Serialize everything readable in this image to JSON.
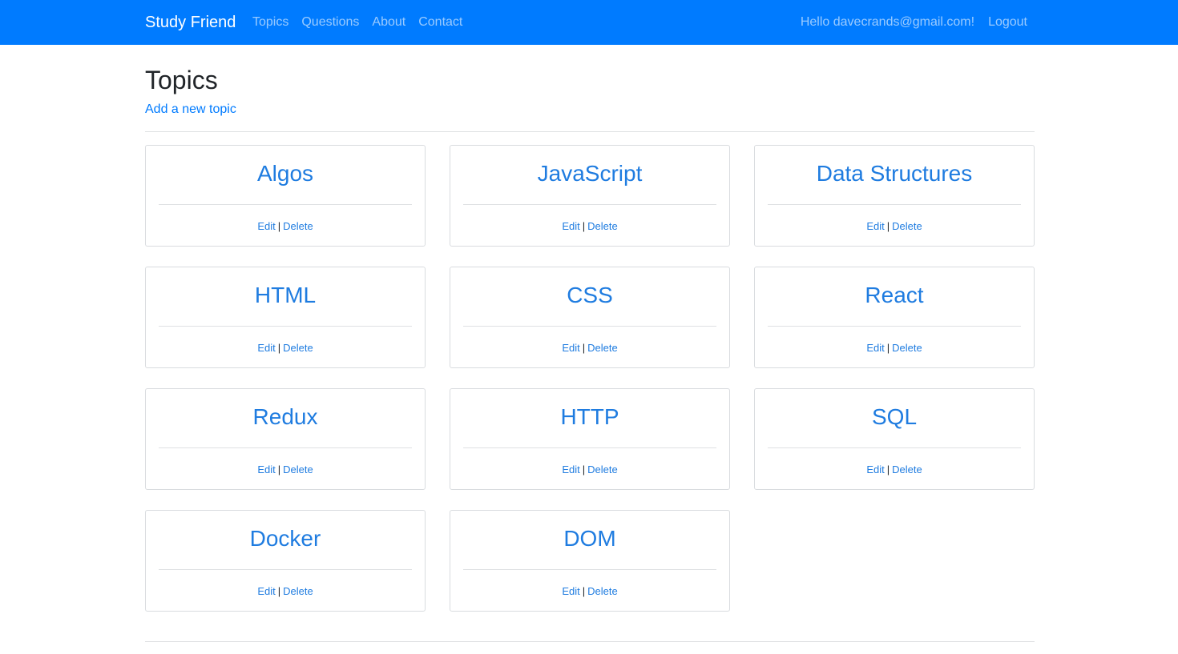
{
  "navbar": {
    "brand": "Study Friend",
    "links": [
      "Topics",
      "Questions",
      "About",
      "Contact"
    ],
    "greeting": "Hello davecrands@gmail.com!",
    "logout": "Logout"
  },
  "page": {
    "title": "Topics",
    "add_link": "Add a new topic"
  },
  "topics": [
    {
      "name": "Algos",
      "edit": "Edit",
      "sep": "|",
      "delete": "Delete"
    },
    {
      "name": "JavaScript",
      "edit": "Edit",
      "sep": "|",
      "delete": "Delete"
    },
    {
      "name": "Data Structures",
      "edit": "Edit",
      "sep": "|",
      "delete": "Delete"
    },
    {
      "name": "HTML",
      "edit": "Edit",
      "sep": "|",
      "delete": "Delete"
    },
    {
      "name": "CSS",
      "edit": "Edit",
      "sep": "|",
      "delete": "Delete"
    },
    {
      "name": "React",
      "edit": "Edit",
      "sep": "|",
      "delete": "Delete"
    },
    {
      "name": "Redux",
      "edit": "Edit",
      "sep": "|",
      "delete": "Delete"
    },
    {
      "name": "HTTP",
      "edit": "Edit",
      "sep": "|",
      "delete": "Delete"
    },
    {
      "name": "SQL",
      "edit": "Edit",
      "sep": "|",
      "delete": "Delete"
    },
    {
      "name": "Docker",
      "edit": "Edit",
      "sep": "|",
      "delete": "Delete"
    },
    {
      "name": "DOM",
      "edit": "Edit",
      "sep": "|",
      "delete": "Delete"
    }
  ],
  "colors": {
    "navbar": "#007bff",
    "link": "#1f7ce0",
    "text": "#212529"
  }
}
